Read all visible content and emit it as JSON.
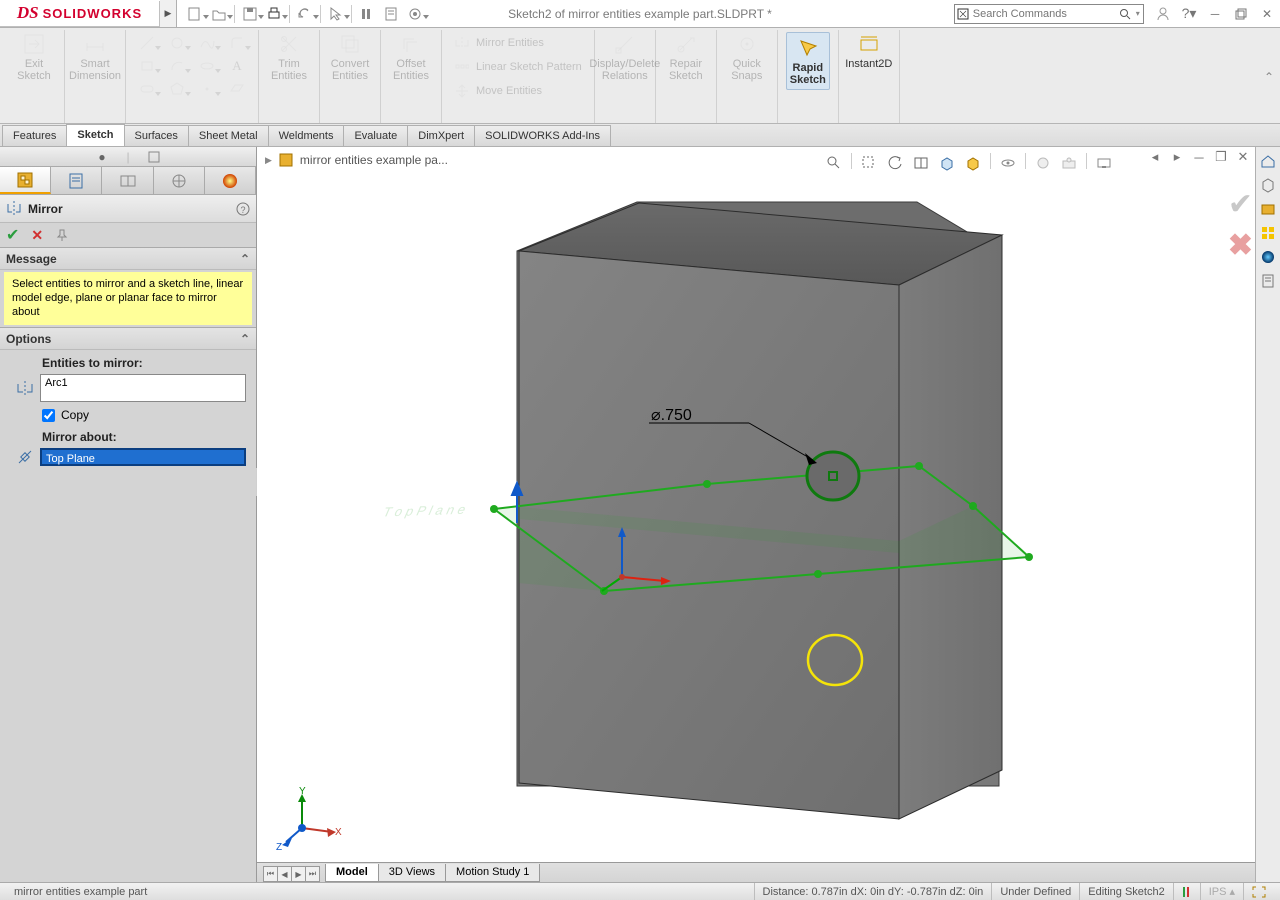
{
  "app": {
    "logo_swoosh": "DS",
    "logo_text": "SOLIDWORKS"
  },
  "doc_title": "Sketch2 of mirror entities example part.SLDPRT *",
  "search_placeholder": "Search Commands",
  "ribbon": {
    "exit_sketch": "Exit\nSketch",
    "smart_dim": "Smart\nDimension",
    "trim": "Trim\nEntities",
    "convert": "Convert\nEntities",
    "offset": "Offset\nEntities",
    "mirror_ent": "Mirror Entities",
    "lin_pat": "Linear Sketch Pattern",
    "move_ent": "Move Entities",
    "disp_del": "Display/Delete\nRelations",
    "repair": "Repair\nSketch",
    "quick": "Quick\nSnaps",
    "rapid": "Rapid\nSketch",
    "instant": "Instant2D"
  },
  "tabs": [
    "Features",
    "Sketch",
    "Surfaces",
    "Sheet Metal",
    "Weldments",
    "Evaluate",
    "DimXpert",
    "SOLIDWORKS Add-Ins"
  ],
  "active_tab": "Sketch",
  "breadcrumb": "mirror entities example pa...",
  "pm": {
    "title": "Mirror",
    "sect_message": "Message",
    "message_text": "Select entities to mirror and a sketch line, linear model edge, plane or planar face to mirror about",
    "sect_options": "Options",
    "lbl_entities": "Entities to mirror:",
    "val_entities": "Arc1",
    "copy": "Copy",
    "lbl_about": "Mirror about:",
    "val_about": "Top Plane"
  },
  "dim_label": "⌀.750",
  "view_tabs": {
    "model": "Model",
    "threed": "3D Views",
    "motion": "Motion Study 1"
  },
  "status": {
    "left": "mirror entities example part",
    "dist": "Distance: 0.787in   dX: 0in   dY: -0.787in   dZ: 0in",
    "def": "Under Defined",
    "edit": "Editing Sketch2",
    "units": "IPS"
  }
}
